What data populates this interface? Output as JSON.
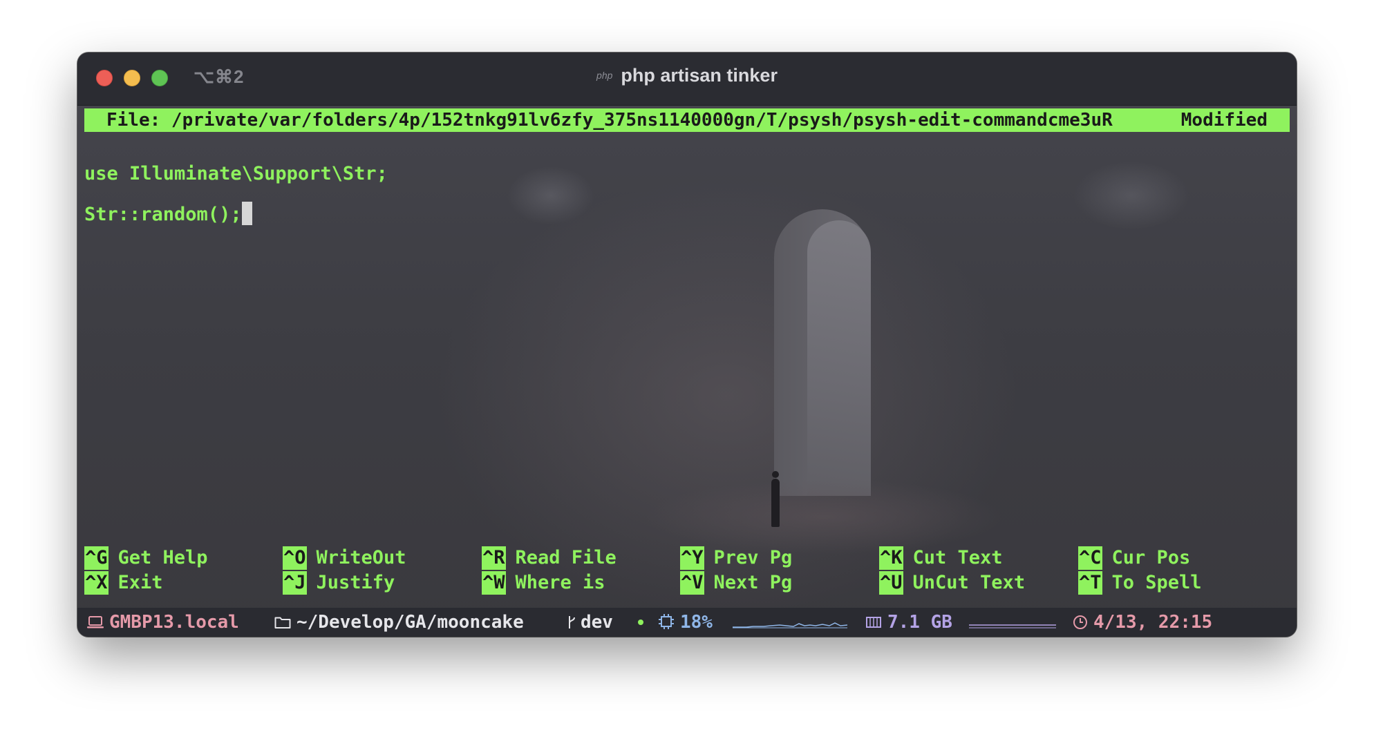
{
  "window": {
    "shortcut": "⌥⌘2",
    "badge": "php",
    "title": "php artisan tinker"
  },
  "editor": {
    "file_label": "File: /private/var/folders/4p/152tnkg91lv6zfy_375ns1140000gn/T/psysh/psysh-edit-commandcme3uR",
    "status": "Modified",
    "lines": [
      "use Illuminate\\Support\\Str;",
      "Str::random();"
    ]
  },
  "shortcuts": [
    {
      "key": "^G",
      "label": "Get Help"
    },
    {
      "key": "^O",
      "label": "WriteOut"
    },
    {
      "key": "^R",
      "label": "Read File"
    },
    {
      "key": "^Y",
      "label": "Prev Pg"
    },
    {
      "key": "^K",
      "label": "Cut Text"
    },
    {
      "key": "^C",
      "label": "Cur Pos"
    },
    {
      "key": "^X",
      "label": "Exit"
    },
    {
      "key": "^J",
      "label": "Justify"
    },
    {
      "key": "^W",
      "label": "Where is"
    },
    {
      "key": "^V",
      "label": "Next Pg"
    },
    {
      "key": "^U",
      "label": "UnCut Text"
    },
    {
      "key": "^T",
      "label": "To Spell"
    }
  ],
  "statusline": {
    "host": "GMBP13.local",
    "path": "~/Develop/GA/mooncake",
    "branch": "dev",
    "cpu": "18%",
    "mem": "7.1 GB",
    "datetime": "4/13, 22:15"
  },
  "colors": {
    "accent_green": "#8ff25e",
    "host_pink": "#e59aa9",
    "cpu_blue": "#8fb6e8",
    "mem_lavender": "#b4a3e6"
  },
  "icons": {
    "host": "laptop-icon",
    "path": "folder-icon",
    "branch": "git-branch-icon",
    "cpu": "cpu-icon",
    "mem": "memory-icon",
    "time": "clock-icon"
  }
}
